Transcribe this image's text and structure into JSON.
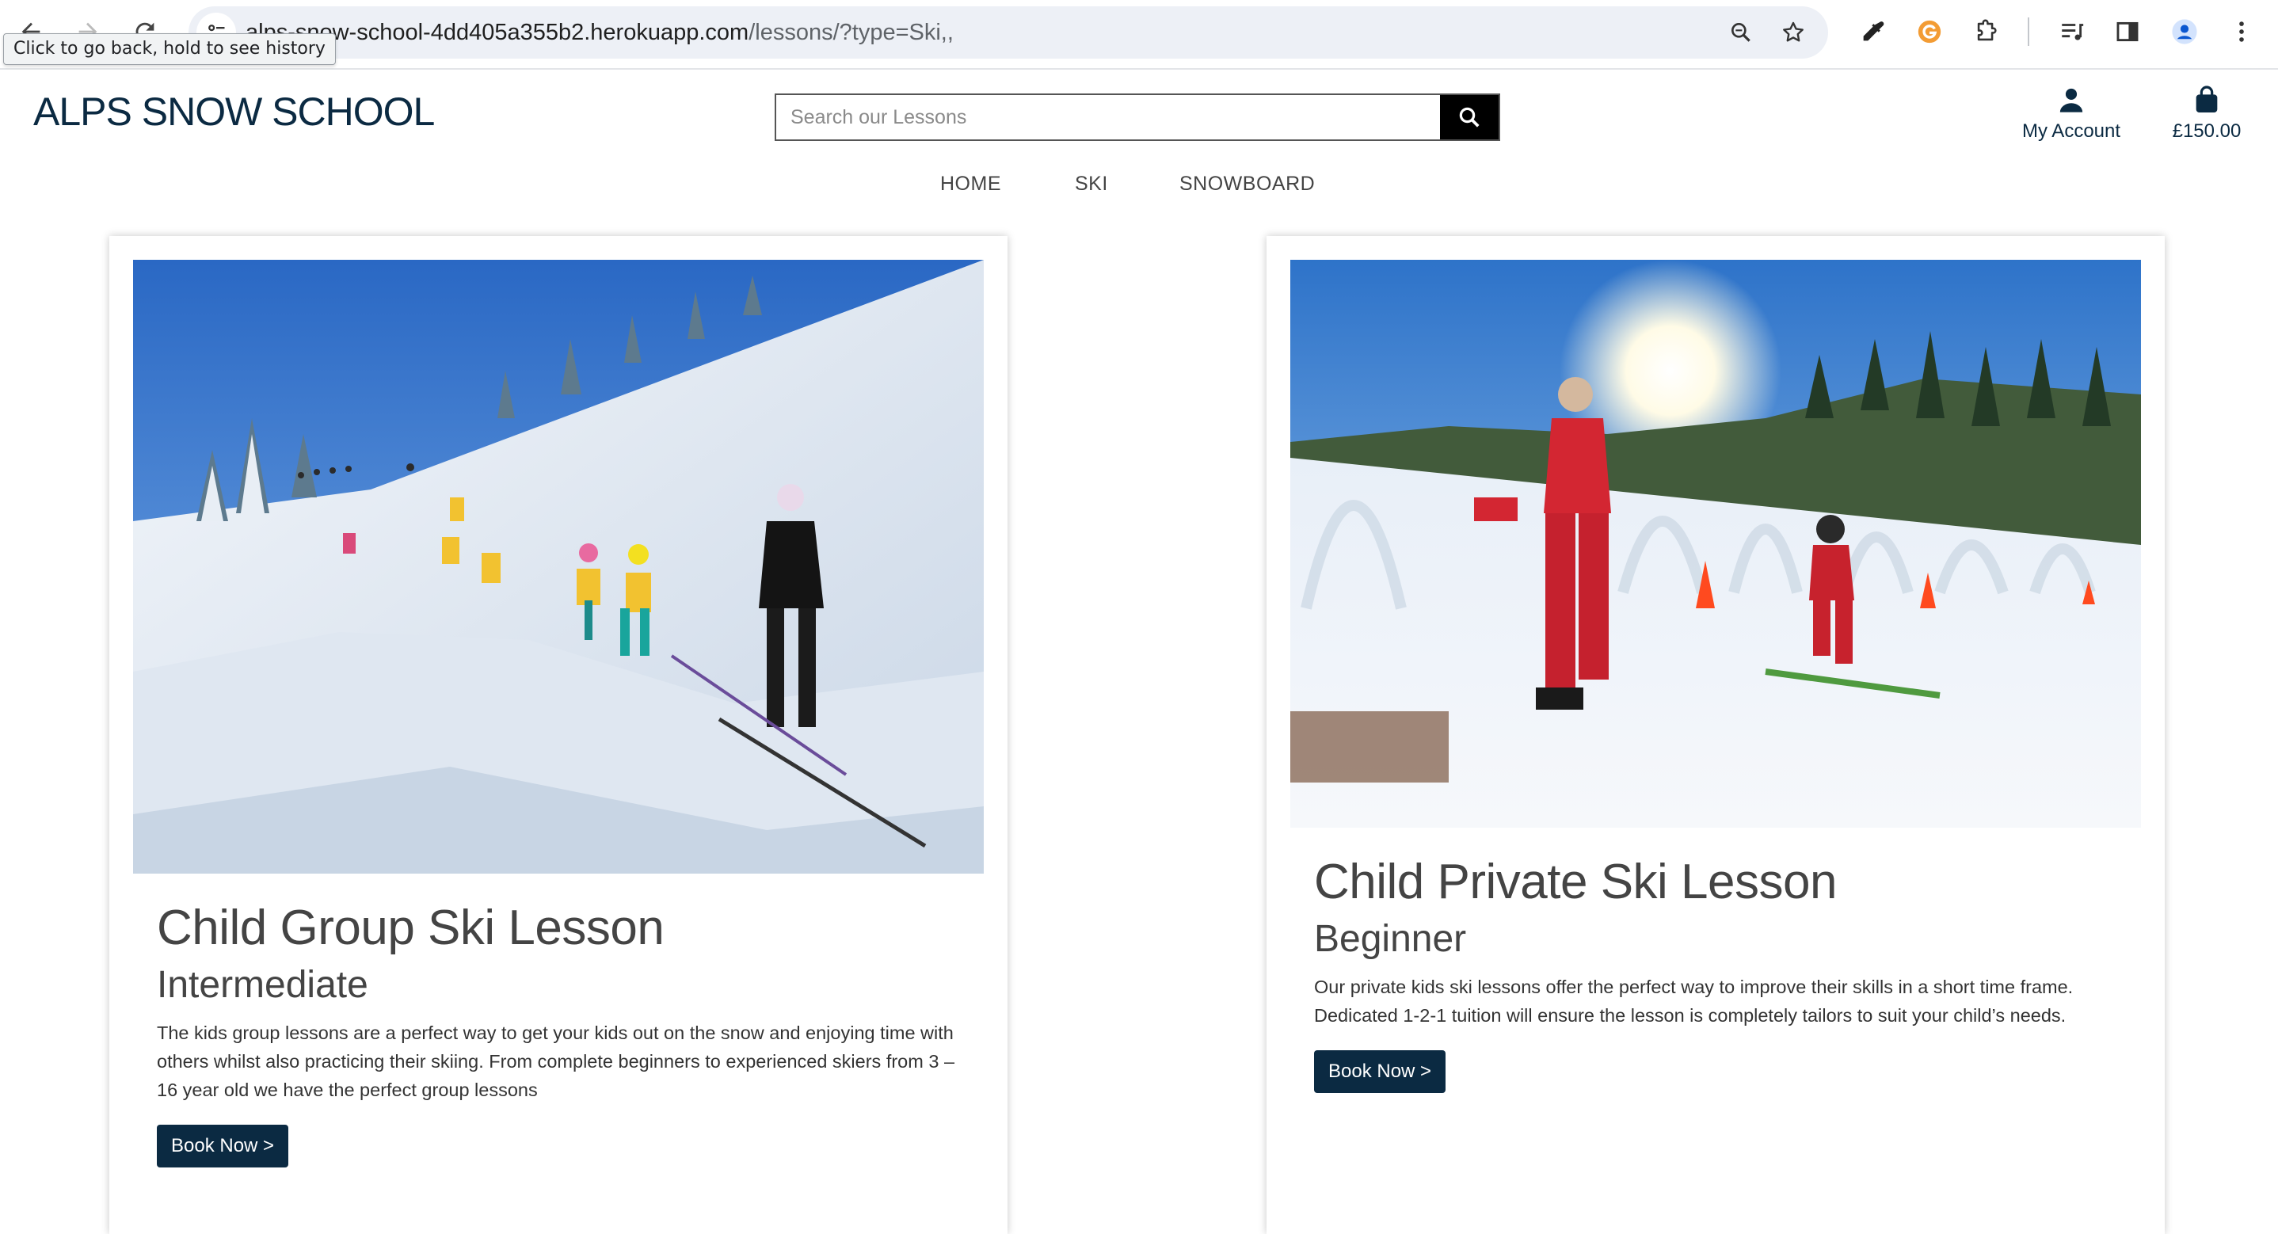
{
  "browser": {
    "url_host": "alps-snow-school-4dd405a355b2.herokuapp.com",
    "url_path": "/lessons/?type=Ski,,",
    "tooltip": "Click to go back, hold to see history"
  },
  "site": {
    "logo": "ALPS SNOW SCHOOL",
    "search_placeholder": "Search our Lessons",
    "account_label": "My Account",
    "bag_total": "£150.00"
  },
  "nav": {
    "items": [
      "HOME",
      "SKI",
      "SNOWBOARD"
    ]
  },
  "lessons": [
    {
      "title": "Child Group Ski Lesson",
      "level": "Intermediate",
      "description": "The kids group lessons are a perfect way to get your kids out on the snow and enjoying time with others whilst also practicing their skiing. From complete beginners to experienced skiers from 3 – 16 year old we have the perfect group lessons",
      "button": "Book Now >"
    },
    {
      "title": "Child Private Ski Lesson",
      "level": "Beginner",
      "description": "Our private kids ski lessons offer the perfect way to improve their skills in a short time frame. Dedicated 1-2-1 tuition will ensure the lesson is completely tailors to suit your child’s needs.",
      "button": "Book Now >"
    }
  ]
}
